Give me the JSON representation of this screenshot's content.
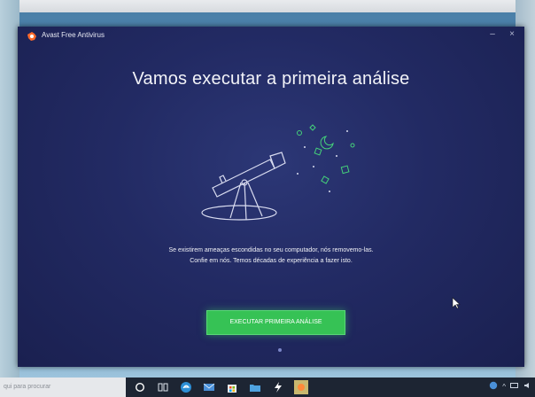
{
  "window": {
    "title": "Avast Free Antivirus",
    "minimize_glyph": "–",
    "close_glyph": "×"
  },
  "main": {
    "heading": "Vamos executar a primeira análise",
    "description_line1": "Se existirem ameaças escondidas no seu computador, nós removemo-las.",
    "description_line2": "Confie em nós. Temos décadas de experiência a fazer isto.",
    "scan_button_label": "EXECUTAR PRIMEIRA ANÁLISE"
  },
  "taskbar": {
    "search_placeholder": "qui para procurar",
    "icons": [
      "cortana-icon",
      "task-view-icon",
      "edge-icon",
      "mail-icon",
      "store-icon",
      "folder-icon",
      "winamp-icon",
      "avast-taskbar-icon"
    ]
  },
  "colors": {
    "background": "#222a63",
    "accent_green": "#36c255",
    "brand_orange": "#ff6a2b"
  }
}
